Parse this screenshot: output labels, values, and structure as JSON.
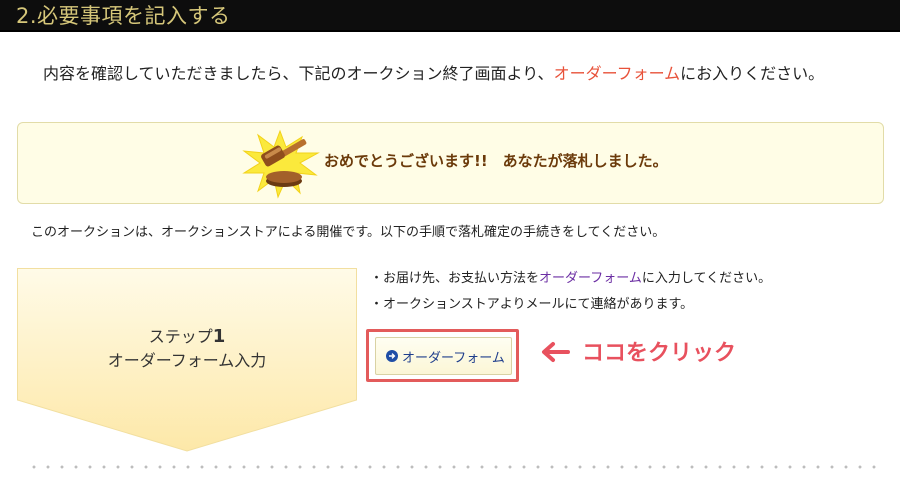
{
  "header": {
    "title": "2.必要事項を記入する"
  },
  "intro": {
    "before": "内容を確認していただきましたら、下記のオークション終了画面より、",
    "link": "オーダーフォーム",
    "after": "にお入りください。"
  },
  "congrats": {
    "icon": "gavel-icon",
    "message": "おめでとうございます!!　あなたが落札しました。"
  },
  "auction_note": "このオークションは、オークションストアによる開催です。以下の手順で落札確定の手続きをしてください。",
  "step": {
    "label": "ステップ",
    "number": "1",
    "name": "オーダーフォーム入力"
  },
  "instructions": {
    "line1_before": "・お届け先、お支払い方法を",
    "line1_link": "オーダーフォーム",
    "line1_after": "に入力してください。",
    "line2": "・オークションストアよりメールにて連絡があります。"
  },
  "order_button": {
    "label": "オーダーフォーム",
    "icon": "arrow-right-circle-icon"
  },
  "click_hint": {
    "icon": "arrow-left-icon",
    "text": "ココをクリック"
  },
  "colors": {
    "header_bg": "#0d0d0d",
    "header_text": "#d6c77a",
    "accent_link": "#e8523a",
    "hint_red": "#e8515e",
    "congrats_bg": "#fffde6"
  }
}
